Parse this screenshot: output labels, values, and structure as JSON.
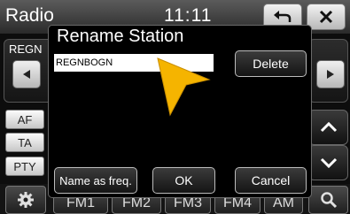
{
  "header": {
    "title": "Radio",
    "time": "11:11",
    "back_icon": "back-arrow-icon",
    "close_icon": "close-icon"
  },
  "station": {
    "name": "REGN"
  },
  "side_buttons": {
    "af": "AF",
    "ta": "TA",
    "pty": "PTY"
  },
  "bands": [
    "FM1",
    "FM2",
    "FM3",
    "FM4",
    "AM"
  ],
  "dialog": {
    "title": "Rename Station",
    "name_value": "REGNBOGN",
    "delete_label": "Delete",
    "name_as_freq_label": "Name as freq.",
    "ok_label": "OK",
    "cancel_label": "Cancel"
  },
  "colors": {
    "cursor": "#f5b400",
    "button_border": "#bcbcbc",
    "field_bg": "#ffffff"
  }
}
